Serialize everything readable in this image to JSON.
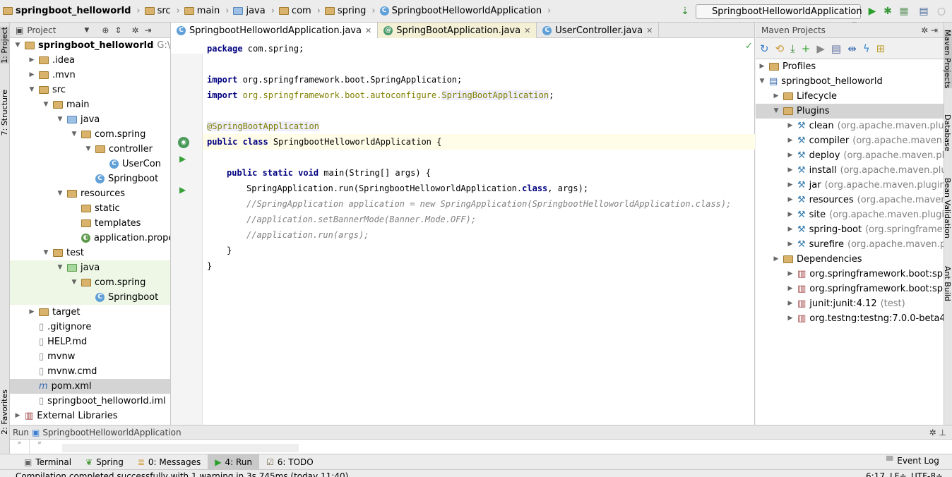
{
  "breadcrumbs": [
    "springboot_helloworld",
    "src",
    "main",
    "java",
    "com",
    "spring",
    "SpringbootHelloworldApplication"
  ],
  "run_config": "SpringbootHelloworldApplication",
  "project_panel": {
    "title": "Project",
    "tree": [
      {
        "label": "springboot_helloworld",
        "suffix": "G:\\spri",
        "level": 0,
        "icon": "folder",
        "expanded": true,
        "bold": true
      },
      {
        "label": ".idea",
        "level": 1,
        "icon": "folder",
        "expanded": false
      },
      {
        "label": ".mvn",
        "level": 1,
        "icon": "folder",
        "expanded": false
      },
      {
        "label": "src",
        "level": 1,
        "icon": "folder",
        "expanded": true
      },
      {
        "label": "main",
        "level": 2,
        "icon": "folder",
        "expanded": true
      },
      {
        "label": "java",
        "level": 3,
        "icon": "folder-blue",
        "expanded": true
      },
      {
        "label": "com.spring",
        "level": 4,
        "icon": "package",
        "expanded": true
      },
      {
        "label": "controller",
        "level": 5,
        "icon": "package",
        "expanded": true
      },
      {
        "label": "UserCon",
        "level": 6,
        "icon": "class"
      },
      {
        "label": "Springboot",
        "level": 5,
        "icon": "spring-class"
      },
      {
        "label": "resources",
        "level": 3,
        "icon": "folder",
        "expanded": true
      },
      {
        "label": "static",
        "level": 4,
        "icon": "folder"
      },
      {
        "label": "templates",
        "level": 4,
        "icon": "folder"
      },
      {
        "label": "application.proper",
        "level": 4,
        "icon": "spring-leaf"
      },
      {
        "label": "test",
        "level": 2,
        "icon": "folder",
        "expanded": true
      },
      {
        "label": "java",
        "level": 3,
        "icon": "folder-green",
        "expanded": true,
        "green": true
      },
      {
        "label": "com.spring",
        "level": 4,
        "icon": "package",
        "expanded": true,
        "green": true
      },
      {
        "label": "Springboot",
        "level": 5,
        "icon": "class",
        "green": true
      },
      {
        "label": "target",
        "level": 1,
        "icon": "folder",
        "expanded": false
      },
      {
        "label": ".gitignore",
        "level": 1,
        "icon": "file"
      },
      {
        "label": "HELP.md",
        "level": 1,
        "icon": "file"
      },
      {
        "label": "mvnw",
        "level": 1,
        "icon": "file"
      },
      {
        "label": "mvnw.cmd",
        "level": 1,
        "icon": "file"
      },
      {
        "label": "pom.xml",
        "level": 1,
        "icon": "maven",
        "selected": true
      },
      {
        "label": "springboot_helloworld.iml",
        "level": 1,
        "icon": "file"
      },
      {
        "label": "External Libraries",
        "level": 0,
        "icon": "library",
        "expanded": false
      }
    ]
  },
  "editor": {
    "tabs": [
      {
        "label": "SpringbootHelloworldApplication.java",
        "active": true
      },
      {
        "label": "SpringBootApplication.java",
        "active": false
      },
      {
        "label": "UserController.java",
        "active": false
      }
    ],
    "code": {
      "l1a": "package",
      "l1b": " com.spring;",
      "l3a": "import",
      "l3b": " org.springframework.boot.SpringApplication;",
      "l4a": "import",
      "l4b": " org.springframework.boot.autoconfigure.",
      "l4c": "SpringBootApplication",
      ";": ";",
      "l6": "@SpringBootApplication",
      "l7a": "public class",
      "l7b": " SpringbootHelloworldApplication {",
      "l9a": "public static void",
      "l9b": " main(String[] args) {",
      "l10a": "SpringApplication.run(SpringbootHelloworldApplication.",
      "l10b": "class",
      ", args);": ", args);",
      "l11": "//SpringApplication application = new SpringApplication(SpringbootHelloworldApplication.class);",
      "l12": "//application.setBannerMode(Banner.Mode.OFF);",
      "l13": "//application.run(args);",
      "l14": "}",
      "l15": "}"
    }
  },
  "maven_panel": {
    "title": "Maven Projects",
    "tree": [
      {
        "label": "Profiles",
        "level": 0
      },
      {
        "label": "springboot_helloworld",
        "level": 0
      },
      {
        "label": "Lifecycle",
        "level": 1
      },
      {
        "label": "Plugins",
        "level": 1,
        "selected": true
      },
      {
        "label": "clean",
        "detail": "(org.apache.maven.plugin",
        "level": 2
      },
      {
        "label": "compiler",
        "detail": "(org.apache.maven.plu",
        "level": 2
      },
      {
        "label": "deploy",
        "detail": "(org.apache.maven.plug",
        "level": 2
      },
      {
        "label": "install",
        "detail": "(org.apache.maven.plugin",
        "level": 2
      },
      {
        "label": "jar",
        "detail": "(org.apache.maven.plugins:m",
        "level": 2
      },
      {
        "label": "resources",
        "detail": "(org.apache.maven.pl",
        "level": 2
      },
      {
        "label": "site",
        "detail": "(org.apache.maven.plugins:",
        "level": 2
      },
      {
        "label": "spring-boot",
        "detail": "(org.springframewo",
        "level": 2
      },
      {
        "label": "surefire",
        "detail": "(org.apache.maven.plug",
        "level": 2
      },
      {
        "label": "Dependencies",
        "level": 1
      },
      {
        "label": "org.springframework.boot:sprin",
        "level": 2
      },
      {
        "label": "org.springframework.boot:sprin",
        "level": 2
      },
      {
        "label": "junit:junit:4.12",
        "detail": "(test)",
        "level": 2
      },
      {
        "label": "org.testng:testng:7.0.0-beta4",
        "detail": "(te",
        "level": 2
      }
    ]
  },
  "side_tabs": {
    "left": [
      "1: Project",
      "7: Structure",
      "2: Favorites"
    ],
    "right": [
      "Maven Projects",
      "Database",
      "Bean Validation",
      "Ant Build"
    ]
  },
  "run_panel": {
    "label": "Run",
    "config": "SpringbootHelloworldApplication"
  },
  "bottom_tools": [
    "Terminal",
    "Spring",
    "0: Messages",
    "4: Run",
    "6: TODO"
  ],
  "event_log": "Event Log",
  "status": {
    "message": "Compilation completed successfully with 1 warning in 3s 745ms (today 11:40)",
    "position": "6:17",
    "line_sep": "LF÷",
    "encoding": "UTF-8÷"
  }
}
